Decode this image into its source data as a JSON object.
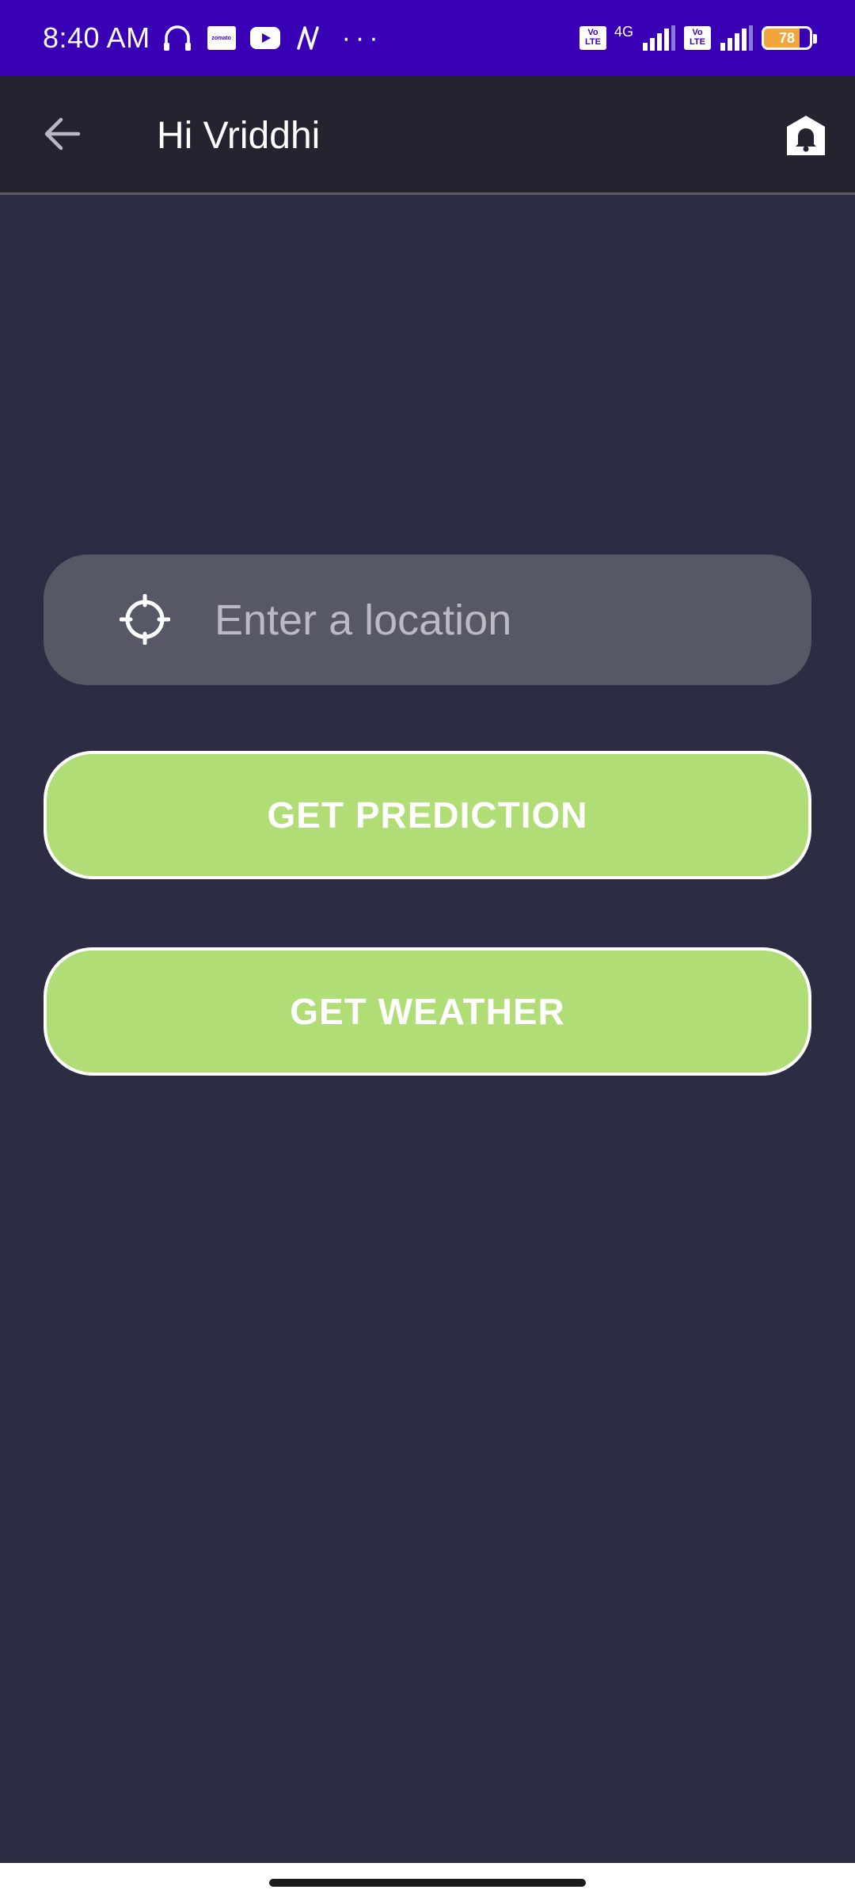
{
  "status_bar": {
    "time": "8:40 AM",
    "network_type": "4G",
    "battery_level": "78",
    "volte_label": "Vo LTE",
    "zomato_label": "zomato",
    "icons": [
      "headphones-icon",
      "zomato-icon",
      "youtube-icon",
      "app-n-icon",
      "more-dots-icon",
      "volte-icon",
      "signal-icon",
      "battery-icon"
    ],
    "more_dots": "···",
    "background_color": "#3a00b6"
  },
  "app_bar": {
    "title": "Hi Vriddhi",
    "back_icon": "arrow-left-icon",
    "notification_icon": "bell-icon",
    "background_color": "#23242f"
  },
  "location": {
    "placeholder": "Enter a location",
    "value": "",
    "icon": "crosshair-icon"
  },
  "buttons": {
    "prediction_label": "GET PREDICTION",
    "weather_label": "GET WEATHER",
    "color": "#b0dd75"
  },
  "page": {
    "background_color": "#2c2d42"
  }
}
